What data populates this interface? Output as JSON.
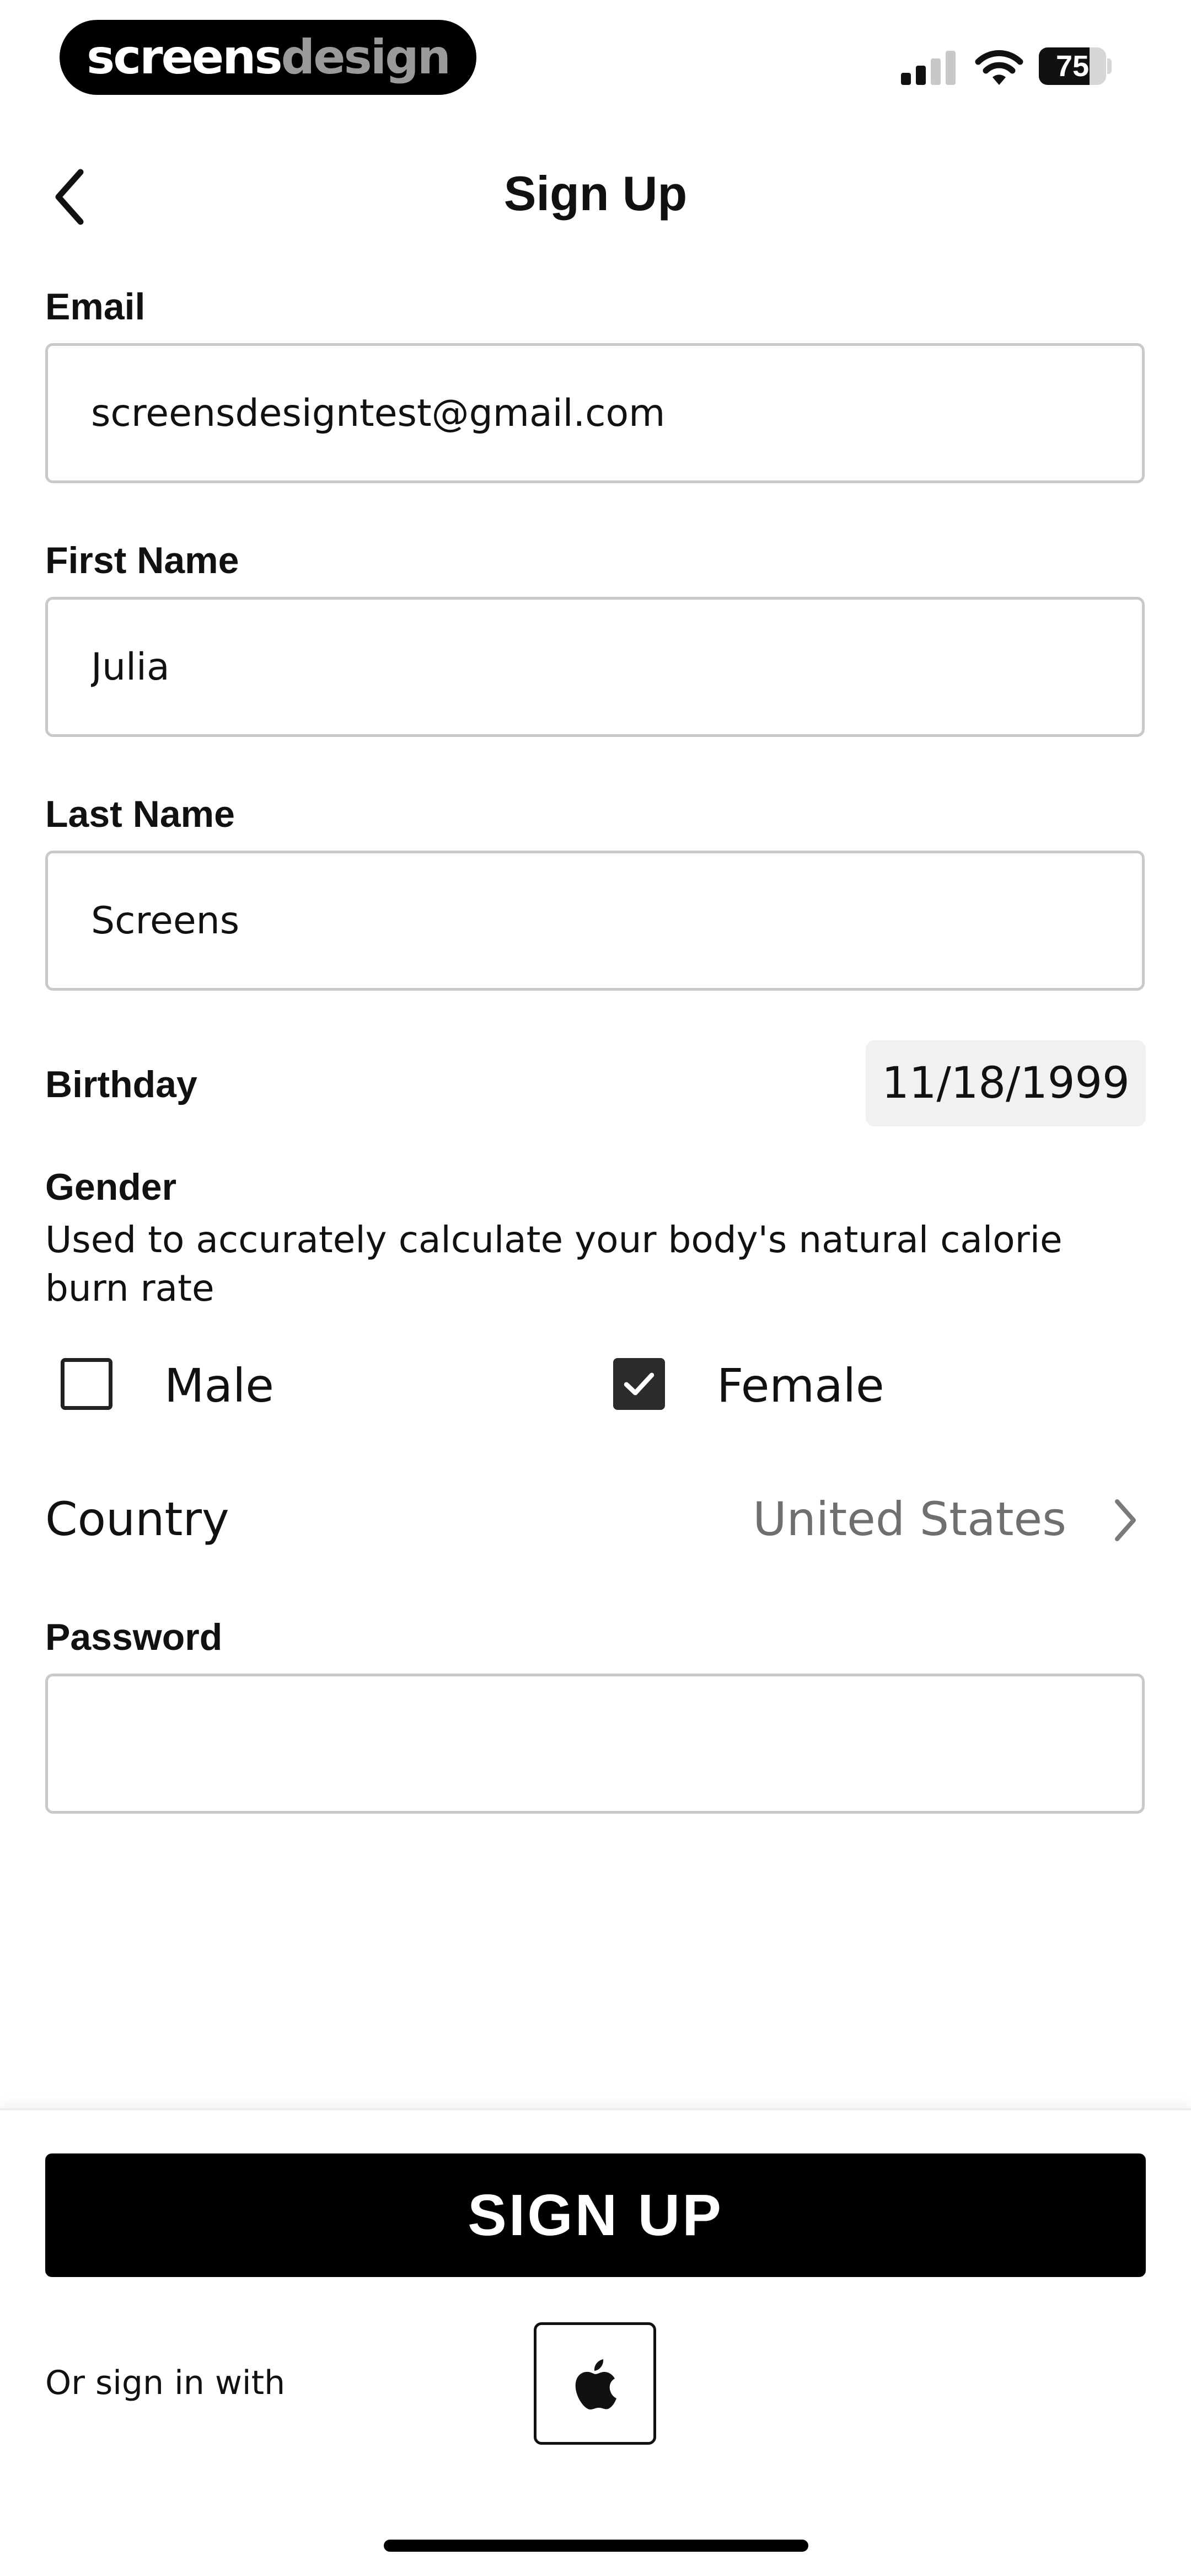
{
  "status_bar": {
    "brand_part1": "screens",
    "brand_part2": "design",
    "battery_level": "75",
    "battery_fraction": 0.75
  },
  "nav": {
    "title": "Sign Up",
    "back_icon": "chevron-left-icon"
  },
  "form": {
    "email": {
      "label": "Email",
      "value": "screensdesigntest@gmail.com"
    },
    "first_name": {
      "label": "First Name",
      "value": "Julia"
    },
    "last_name": {
      "label": "Last Name",
      "value": "Screens"
    },
    "birthday": {
      "label": "Birthday",
      "value": "11/18/1999"
    },
    "gender": {
      "label": "Gender",
      "helper": "Used to accurately calculate your body's natural calorie burn rate",
      "options": [
        {
          "label": "Male",
          "checked": false
        },
        {
          "label": "Female",
          "checked": true
        }
      ]
    },
    "country": {
      "label": "Country",
      "value": "United States"
    },
    "password": {
      "label": "Password",
      "value": ""
    }
  },
  "actions": {
    "signup_label": "SIGN UP",
    "or_text": "Or sign in with",
    "apple_icon": "apple-icon"
  },
  "colors": {
    "primary": "#000000",
    "border": "#c9c9c9",
    "muted_text": "#6f6f6f",
    "chip_bg": "#f1f1f1"
  }
}
